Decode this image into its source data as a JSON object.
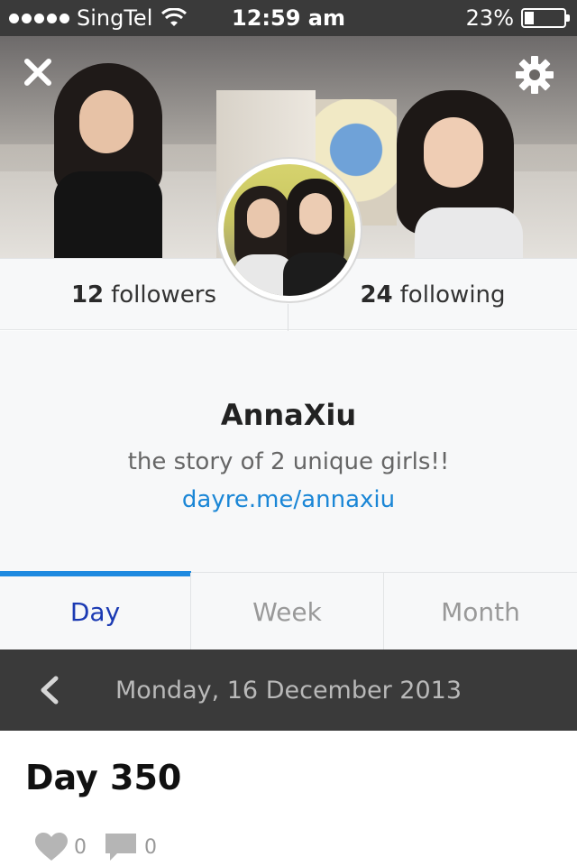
{
  "status_bar": {
    "carrier": "SingTel",
    "time": "12:59 am",
    "battery_text": "23%",
    "battery_level": 0.23
  },
  "profile": {
    "followers_count": "12",
    "followers_label": "followers",
    "following_count": "24",
    "following_label": "following",
    "username": "AnnaXiu",
    "bio": "the story of 2 unique girls!!",
    "link": "dayre.me/annaxiu"
  },
  "tabs": [
    {
      "label": "Day",
      "active": true
    },
    {
      "label": "Week",
      "active": false
    },
    {
      "label": "Month",
      "active": false
    }
  ],
  "date_bar": {
    "date": "Monday, 16 December 2013"
  },
  "post": {
    "title": "Day 350",
    "likes": "0",
    "comments": "0"
  },
  "icons": {
    "close": "close-icon",
    "settings": "gear-icon",
    "back": "chevron-left-icon",
    "like": "heart-icon",
    "comment": "comment-icon"
  },
  "colors": {
    "accent": "#1e8ae0",
    "link": "#1a86d6",
    "active_tab": "#1b3ab3",
    "dark_bar": "#3a3a3a"
  }
}
